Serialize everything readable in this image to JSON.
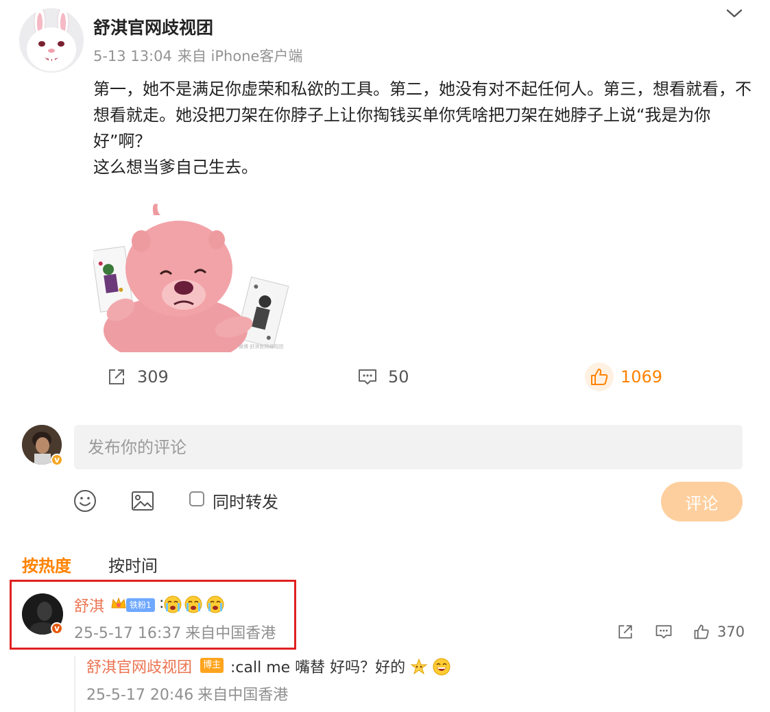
{
  "post": {
    "author": "舒淇官网歧视团",
    "date": "5-13 13:04",
    "source": "来自 iPhone客户端",
    "paragraphs": [
      "第一，她不是满足你虚荣和私欲的工具。第二，她没有对不起任何人。第三，想看就看，不想看就走。她没把刀架在你脖子上让你掏钱买单你凭啥把刀架在她脖子上说“我是为你好”啊？",
      "这么想当爹自己生去。"
    ],
    "image_watermark": "微博 舒淇官网歧视团"
  },
  "actions": {
    "repost_count": "309",
    "comment_count": "50",
    "like_count": "1069"
  },
  "composer": {
    "placeholder": "发布你的评论",
    "repost_label": "同时转发",
    "submit_label": "评论"
  },
  "sort_tabs": {
    "hot": "按热度",
    "time": "按时间"
  },
  "comment": {
    "author": "舒淇",
    "fan_badge": "铁粉1",
    "separator": ":",
    "date": "25-5-17 16:37",
    "source": "来自中国香港",
    "like_count": "370"
  },
  "reply": {
    "author": "舒淇官网歧视团",
    "badge": "博主",
    "text": ":call me 嘴替 好吗？好的",
    "date": "25-5-17 20:46",
    "source": "来自中国香港"
  },
  "colors": {
    "accent": "#ff8200",
    "link_name": "#eb7350",
    "submit_disabled": "#fecf9e",
    "highlight": "#e02020"
  }
}
